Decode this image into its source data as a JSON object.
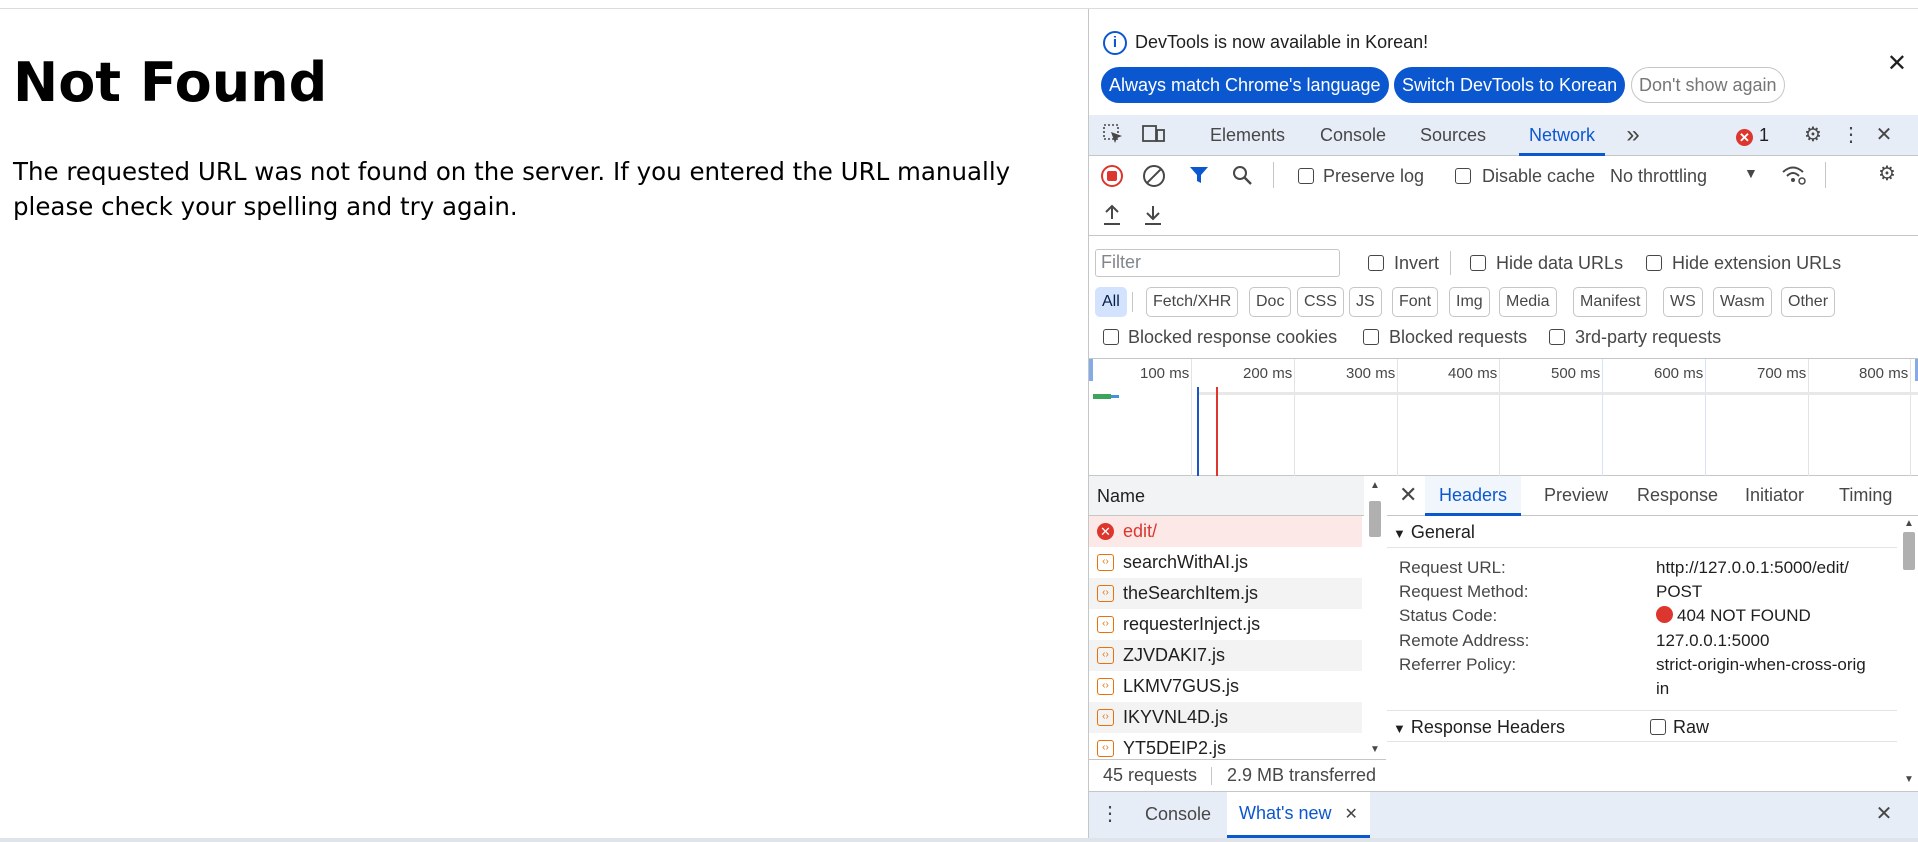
{
  "page": {
    "heading": "Not Found",
    "body": "The requested URL was not found on the server. If you entered the URL manually please check your spelling and try again."
  },
  "devtools": {
    "banner": {
      "message": "DevTools is now available in Korean!",
      "buttons": [
        "Always match Chrome's language",
        "Switch DevTools to Korean",
        "Don't show again"
      ]
    },
    "tabs": [
      "Elements",
      "Console",
      "Sources",
      "Network"
    ],
    "active_tab": "Network",
    "more_tabs": "»",
    "error_count": "1",
    "toolbar": {
      "preserve_log": "Preserve log",
      "disable_cache": "Disable cache",
      "throttling": "No throttling"
    },
    "filter": {
      "placeholder": "Filter",
      "invert": "Invert",
      "hide_data_urls": "Hide data URLs",
      "hide_extension_urls": "Hide extension URLs",
      "types": [
        "All",
        "Fetch/XHR",
        "Doc",
        "CSS",
        "JS",
        "Font",
        "Img",
        "Media",
        "Manifest",
        "WS",
        "Wasm",
        "Other"
      ],
      "active_type": "All",
      "blocked_response_cookies": "Blocked response cookies",
      "blocked_requests": "Blocked requests",
      "third_party_requests": "3rd-party requests"
    },
    "timeline": {
      "ticks": [
        "100 ms",
        "200 ms",
        "300 ms",
        "400 ms",
        "500 ms",
        "600 ms",
        "700 ms",
        "800 ms"
      ]
    },
    "requests": {
      "column": "Name",
      "rows": [
        "edit/",
        "searchWithAI.js",
        "theSearchItem.js",
        "requesterInject.js",
        "ZJVDAKI7.js",
        "LKMV7GUS.js",
        "IKYVNL4D.js",
        "YT5DEIP2.js"
      ],
      "summary_count": "45 requests",
      "summary_transferred": "2.9 MB transferred"
    },
    "detail": {
      "tabs": [
        "Headers",
        "Preview",
        "Response",
        "Initiator",
        "Timing"
      ],
      "active_tab": "Headers",
      "general_title": "General",
      "general": [
        {
          "key": "Request URL:",
          "value": "http://127.0.0.1:5000/edit/"
        },
        {
          "key": "Request Method:",
          "value": "POST"
        },
        {
          "key": "Status Code:",
          "value": "404 NOT FOUND"
        },
        {
          "key": "Remote Address:",
          "value": "127.0.0.1:5000"
        },
        {
          "key": "Referrer Policy:",
          "value": "strict-origin-when-cross-orig"
        },
        {
          "key": "",
          "value": "in"
        }
      ],
      "response_headers_title": "Response Headers",
      "raw_label": "Raw"
    },
    "drawer": {
      "tabs": [
        "Console",
        "What's new"
      ],
      "active_tab": "What's new"
    },
    "colors": {
      "accent": "#0b57d0",
      "error": "#dc362e",
      "tabbar_bg": "#e7edf7"
    }
  }
}
